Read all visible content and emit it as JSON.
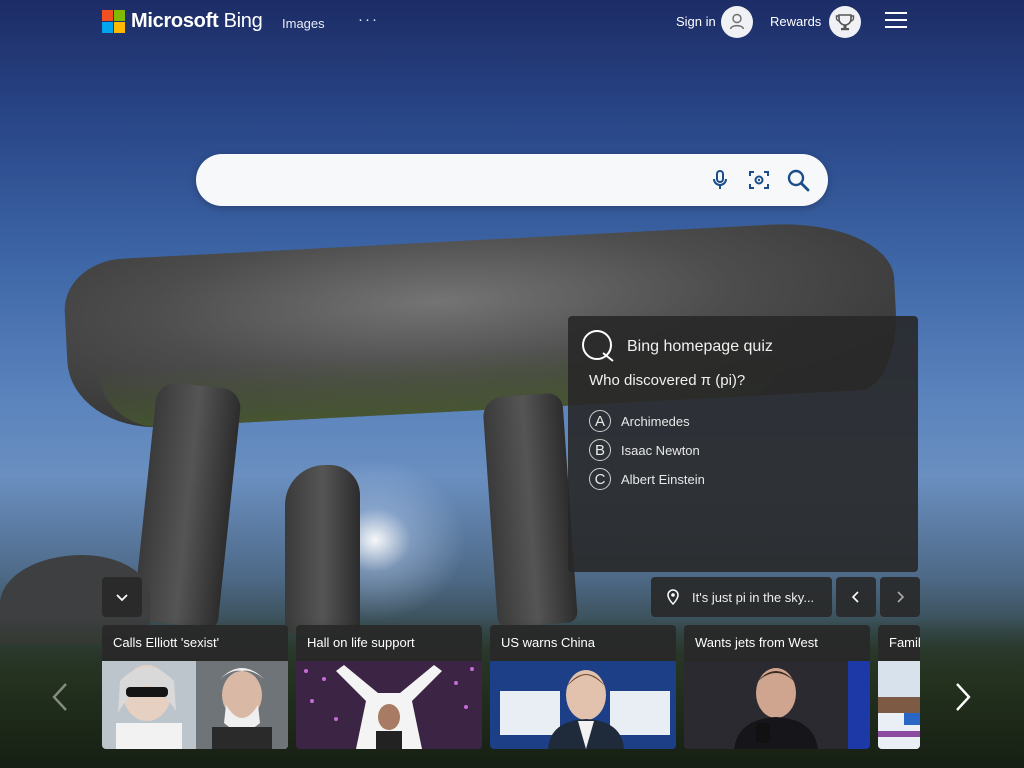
{
  "header": {
    "brand_bold": "Microsoft",
    "brand_rest": " Bing",
    "nav_images": "Images",
    "nav_more": "···",
    "sign_in": "Sign in",
    "rewards": "Rewards",
    "icons": {
      "avatar": "user-avatar-icon",
      "rewards": "trophy-icon",
      "menu": "hamburger-menu-icon"
    }
  },
  "brand_colors": [
    "#f25022",
    "#7fba00",
    "#00a4ef",
    "#ffb900"
  ],
  "search": {
    "value": "",
    "icons": [
      "microphone-icon",
      "visual-search-icon",
      "search-icon"
    ]
  },
  "quiz": {
    "title": "Bing homepage quiz",
    "question": "Who discovered π (pi)?",
    "options": [
      {
        "letter": "A",
        "text": "Archimedes"
      },
      {
        "letter": "B",
        "text": "Isaac Newton"
      },
      {
        "letter": "C",
        "text": "Albert Einstein"
      }
    ]
  },
  "image_caption": {
    "text": "It's just pi in the sky..."
  },
  "news": [
    {
      "title": "Calls Elliott 'sexist'"
    },
    {
      "title": "Hall on life support"
    },
    {
      "title": "US warns China"
    },
    {
      "title": "Wants jets from West"
    },
    {
      "title": "Family"
    }
  ]
}
